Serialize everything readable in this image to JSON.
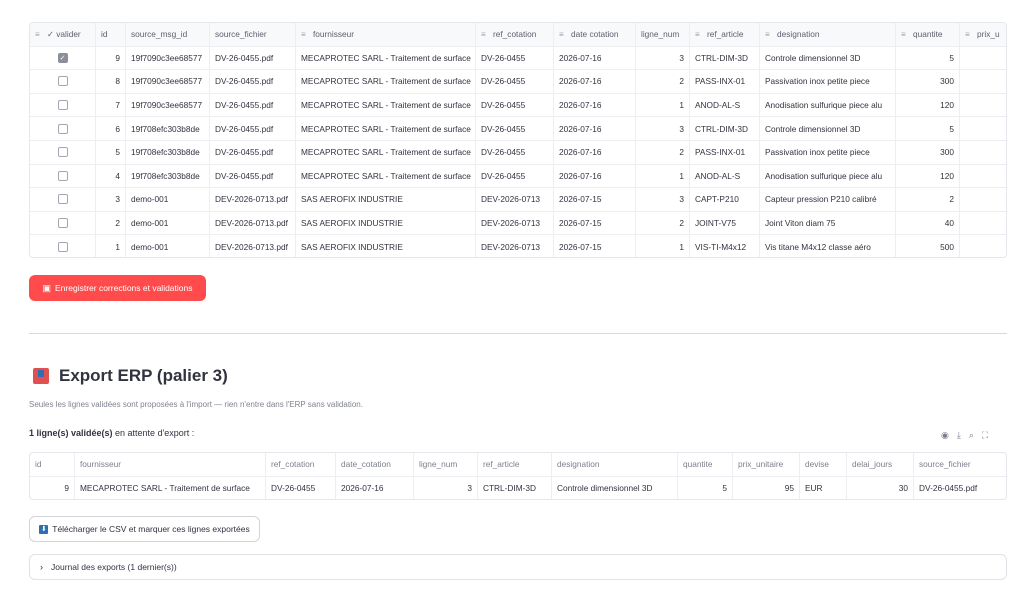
{
  "grid": {
    "columns": [
      {
        "label": "✓ valider",
        "icon": "text-column-icon"
      },
      {
        "label": "id",
        "icon": ""
      },
      {
        "label": "source_msg_id",
        "icon": ""
      },
      {
        "label": "source_fichier",
        "icon": ""
      },
      {
        "label": "fournisseur",
        "icon": "text-column-icon"
      },
      {
        "label": "ref_cotation",
        "icon": "text-column-icon"
      },
      {
        "label": "date cotation",
        "icon": "text-column-icon"
      },
      {
        "label": "ligne_num",
        "icon": ""
      },
      {
        "label": "ref_article",
        "icon": "text-column-icon"
      },
      {
        "label": "designation",
        "icon": "text-column-icon"
      },
      {
        "label": "quantite",
        "icon": "text-column-icon"
      },
      {
        "label": "prix_u",
        "icon": "text-column-icon"
      }
    ],
    "rows": [
      {
        "valider": true,
        "id": "9",
        "msg": "19f7090c3ee68577",
        "fichier": "DV-26-0455.pdf",
        "fournisseur": "MECAPROTEC SARL - Traitement de surface",
        "ref": "DV-26-0455",
        "date": "2026-07-16",
        "ligne": "3",
        "article": "CTRL-DIM-3D",
        "designation": "Controle dimensionnel 3D",
        "quantite": "5"
      },
      {
        "valider": false,
        "id": "8",
        "msg": "19f7090c3ee68577",
        "fichier": "DV-26-0455.pdf",
        "fournisseur": "MECAPROTEC SARL - Traitement de surface",
        "ref": "DV-26-0455",
        "date": "2026-07-16",
        "ligne": "2",
        "article": "PASS-INX-01",
        "designation": "Passivation inox petite piece",
        "quantite": "300"
      },
      {
        "valider": false,
        "id": "7",
        "msg": "19f7090c3ee68577",
        "fichier": "DV-26-0455.pdf",
        "fournisseur": "MECAPROTEC SARL - Traitement de surface",
        "ref": "DV-26-0455",
        "date": "2026-07-16",
        "ligne": "1",
        "article": "ANOD-AL-S",
        "designation": "Anodisation sulfurique piece alu",
        "quantite": "120"
      },
      {
        "valider": false,
        "id": "6",
        "msg": "19f708efc303b8de",
        "fichier": "DV-26-0455.pdf",
        "fournisseur": "MECAPROTEC SARL - Traitement de surface",
        "ref": "DV-26-0455",
        "date": "2026-07-16",
        "ligne": "3",
        "article": "CTRL-DIM-3D",
        "designation": "Controle dimensionnel 3D",
        "quantite": "5"
      },
      {
        "valider": false,
        "id": "5",
        "msg": "19f708efc303b8de",
        "fichier": "DV-26-0455.pdf",
        "fournisseur": "MECAPROTEC SARL - Traitement de surface",
        "ref": "DV-26-0455",
        "date": "2026-07-16",
        "ligne": "2",
        "article": "PASS-INX-01",
        "designation": "Passivation inox petite piece",
        "quantite": "300"
      },
      {
        "valider": false,
        "id": "4",
        "msg": "19f708efc303b8de",
        "fichier": "DV-26-0455.pdf",
        "fournisseur": "MECAPROTEC SARL - Traitement de surface",
        "ref": "DV-26-0455",
        "date": "2026-07-16",
        "ligne": "1",
        "article": "ANOD-AL-S",
        "designation": "Anodisation sulfurique piece alu",
        "quantite": "120"
      },
      {
        "valider": false,
        "id": "3",
        "msg": "demo-001",
        "fichier": "DEV-2026-0713.pdf",
        "fournisseur": "SAS AEROFIX INDUSTRIE",
        "ref": "DEV-2026-0713",
        "date": "2026-07-15",
        "ligne": "3",
        "article": "CAPT-P210",
        "designation": "Capteur pression P210 calibré",
        "quantite": "2"
      },
      {
        "valider": false,
        "id": "2",
        "msg": "demo-001",
        "fichier": "DEV-2026-0713.pdf",
        "fournisseur": "SAS AEROFIX INDUSTRIE",
        "ref": "DEV-2026-0713",
        "date": "2026-07-15",
        "ligne": "2",
        "article": "JOINT-V75",
        "designation": "Joint Viton diam 75",
        "quantite": "40"
      },
      {
        "valider": false,
        "id": "1",
        "msg": "demo-001",
        "fichier": "DEV-2026-0713.pdf",
        "fournisseur": "SAS AEROFIX INDUSTRIE",
        "ref": "DEV-2026-0713",
        "date": "2026-07-15",
        "ligne": "1",
        "article": "VIS-TI-M4x12",
        "designation": "Vis titane M4x12 classe aéro",
        "quantite": "500"
      }
    ]
  },
  "save_button": {
    "icon": "floppy-disk-icon",
    "label": "Enregistrer corrections et validations"
  },
  "export": {
    "icon": "outbox-tray-icon",
    "title": "Export ERP (palier 3)",
    "caption": "Seules les lignes validées sont proposées à l'import — rien n'entre dans l'ERP sans validation.",
    "pending_bold": "1 ligne(s) validée(s)",
    "pending_rest": " en attente d'export :",
    "toolbar_icons": [
      "eye-icon",
      "download-icon",
      "search-icon",
      "fullscreen-icon"
    ],
    "columns": [
      "id",
      "fournisseur",
      "ref_cotation",
      "date_cotation",
      "ligne_num",
      "ref_article",
      "designation",
      "quantite",
      "prix_unitaire",
      "devise",
      "delai_jours",
      "source_fichier"
    ],
    "row": {
      "id": "9",
      "fournisseur": "MECAPROTEC SARL - Traitement de surface",
      "ref": "DV-26-0455",
      "date": "2026-07-16",
      "ligne": "3",
      "article": "CTRL-DIM-3D",
      "designation": "Controle dimensionnel 3D",
      "quantite": "5",
      "prix": "95",
      "devise": "EUR",
      "delai": "30",
      "source": "DV-26-0455.pdf"
    }
  },
  "download_button": {
    "icon": "download-arrow-icon",
    "label": "Télécharger le CSV et marquer ces lignes exportées"
  },
  "journal": {
    "label": "Journal des exports (1 dernier(s))"
  },
  "colors": {
    "primary": "#ff4b4b",
    "text": "#31333f",
    "muted": "#80838f",
    "checkbox_checked": "#8c8f9a"
  }
}
